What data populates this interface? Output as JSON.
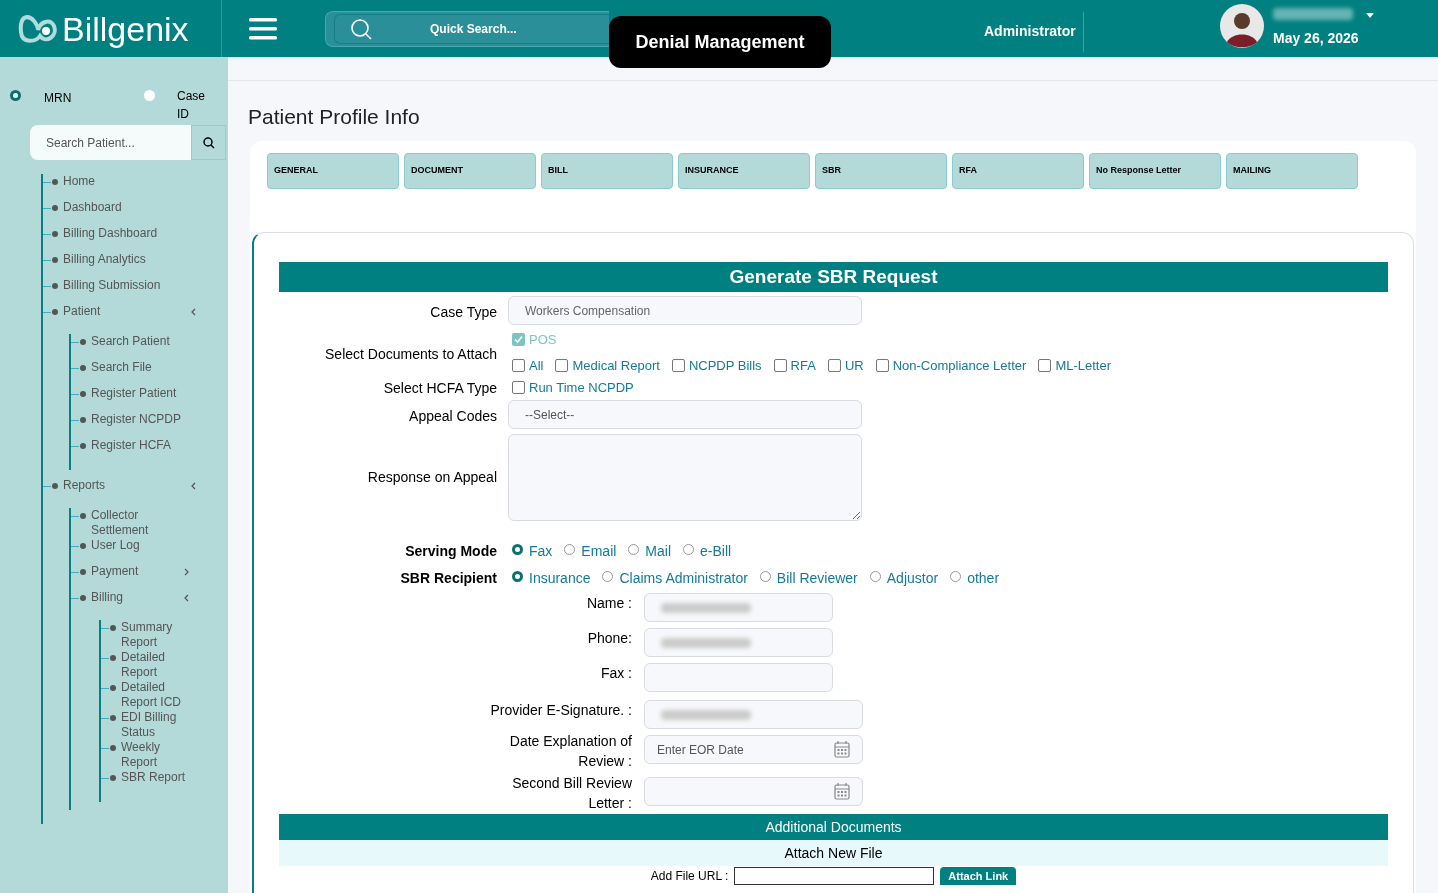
{
  "header": {
    "logo": "Billgenix",
    "search_placeholder": "Quick Search...",
    "page_badge": "Denial Management",
    "role": "Administrator",
    "date": "May 26, 2026"
  },
  "sidebar": {
    "search_by": [
      {
        "label": "MRN",
        "selected": true
      },
      {
        "label": "Case ID",
        "selected": false
      }
    ],
    "search_placeholder": "Search Patient...",
    "items": [
      {
        "label": "Home"
      },
      {
        "label": "Dashboard"
      },
      {
        "label": "Billing Dashboard"
      },
      {
        "label": "Billing Analytics"
      },
      {
        "label": "Billing Submission"
      },
      {
        "label": "Patient",
        "expanded": true,
        "children": [
          {
            "label": "Search Patient"
          },
          {
            "label": "Search File"
          },
          {
            "label": "Register Patient"
          },
          {
            "label": "Register NCPDP"
          },
          {
            "label": "Register HCFA"
          }
        ]
      },
      {
        "label": "Reports",
        "expanded": true,
        "children": [
          {
            "label": "Collector Settlement"
          },
          {
            "label": "User Log"
          },
          {
            "label": "Payment",
            "expanded": false
          },
          {
            "label": "Billing",
            "expanded": true,
            "children": [
              {
                "label": "Summary Report"
              },
              {
                "label": "Detailed Report"
              },
              {
                "label": "Detailed Report ICD"
              },
              {
                "label": "EDI Billing Status"
              },
              {
                "label": "Weekly Report"
              },
              {
                "label": "SBR Report"
              }
            ]
          }
        ]
      }
    ]
  },
  "page_title": "Patient Profile Info",
  "tabs": [
    {
      "label": "GENERAL",
      "selected": false
    },
    {
      "label": "DOCUMENT",
      "selected": false
    },
    {
      "label": "BILL",
      "selected": false
    },
    {
      "label": "INSURANCE",
      "selected": false
    },
    {
      "label": "SBR",
      "selected": false
    },
    {
      "label": "RFA",
      "selected": false
    },
    {
      "label": "No Response Letter",
      "selected": false
    },
    {
      "label": "MAILING",
      "selected": false
    }
  ],
  "form": {
    "title": "Generate SBR Request",
    "case_type": {
      "label": "Case Type",
      "value": "Workers Compensation"
    },
    "documents": {
      "label": "Select Documents to Attach",
      "options": [
        {
          "label": "POS",
          "checked": true,
          "disabled": true
        },
        {
          "label": "All",
          "checked": false,
          "disabled": false
        },
        {
          "label": "Medical Report",
          "checked": false,
          "disabled": false
        },
        {
          "label": "NCPDP Bills",
          "checked": false,
          "disabled": false
        },
        {
          "label": "RFA",
          "checked": false,
          "disabled": false
        },
        {
          "label": "UR",
          "checked": false,
          "disabled": false
        },
        {
          "label": "Non-Compliance Letter",
          "checked": false,
          "disabled": false
        },
        {
          "label": "ML-Letter",
          "checked": false,
          "disabled": false
        }
      ]
    },
    "hcfa_type": {
      "label": "Select HCFA Type",
      "options": [
        {
          "label": "Run Time NCPDP",
          "checked": false
        }
      ]
    },
    "appeal_codes": {
      "label": "Appeal Codes",
      "value": "--Select--"
    },
    "response": {
      "label": "Response on Appeal"
    },
    "serving_mode": {
      "label": "Serving Mode",
      "options": [
        {
          "label": "Fax",
          "selected": true
        },
        {
          "label": "Email",
          "selected": false
        },
        {
          "label": "Mail",
          "selected": false
        },
        {
          "label": "e-Bill",
          "selected": false
        }
      ]
    },
    "recipient": {
      "label": "SBR Recipient",
      "options": [
        {
          "label": "Insurance",
          "selected": true
        },
        {
          "label": "Claims Administrator",
          "selected": false
        },
        {
          "label": "Bill Reviewer",
          "selected": false
        },
        {
          "label": "Adjustor",
          "selected": false
        },
        {
          "label": "other",
          "selected": false
        }
      ]
    },
    "details": [
      {
        "kind": "text",
        "label": "Name :",
        "blurred": true
      },
      {
        "kind": "text",
        "label": "Phone:",
        "blurred": true
      },
      {
        "kind": "text",
        "label": "Fax   :",
        "blurred": false
      },
      {
        "kind": "wide",
        "label": "Provider E-Signature. :",
        "blurred": true
      },
      {
        "kind": "date",
        "label": "Date Explanation of Review   :",
        "placeholder": "Enter EOR Date"
      },
      {
        "kind": "date",
        "label": "Second Bill Review Letter   :"
      }
    ],
    "additional": {
      "title": "Additional Documents",
      "subtitle": "Attach New File",
      "url_label": "Add File URL :",
      "button": "Attach Link"
    }
  }
}
